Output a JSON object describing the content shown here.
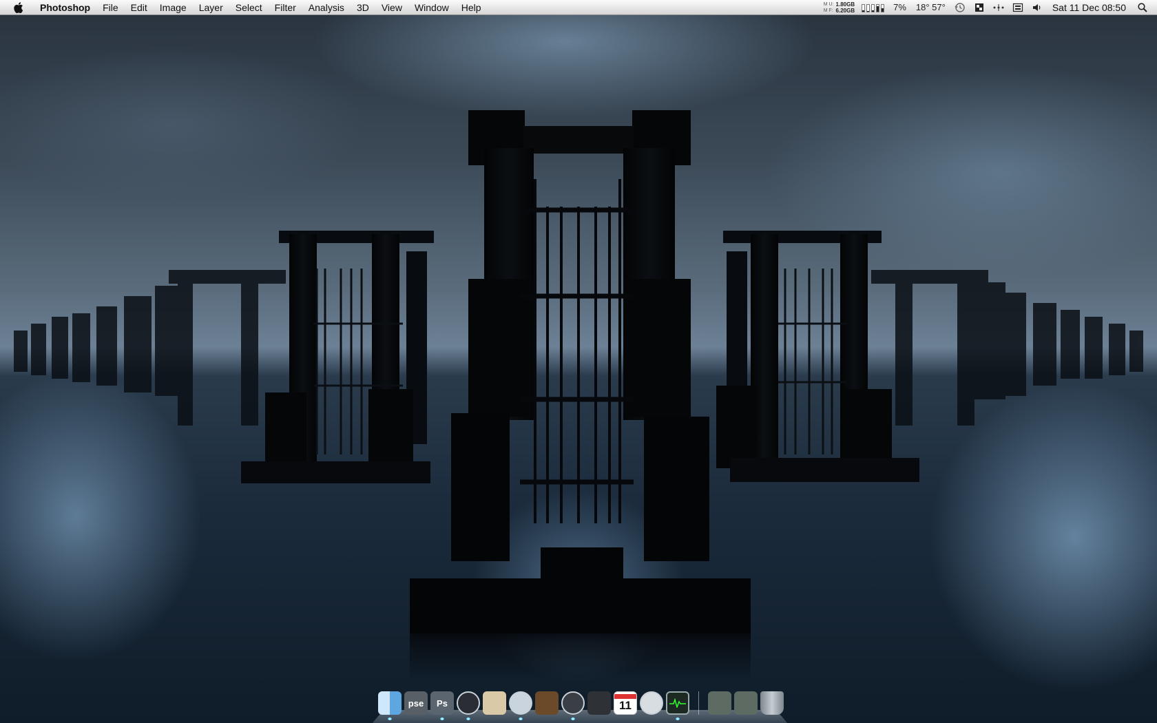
{
  "menubar": {
    "apple_icon": "apple-logo-icon",
    "app_name": "Photoshop",
    "menus": [
      "File",
      "Edit",
      "Image",
      "Layer",
      "Select",
      "Filter",
      "Analysis",
      "3D",
      "View",
      "Window",
      "Help"
    ],
    "memory": {
      "label_top": "M U:",
      "label_bottom": "M F:",
      "used": "1.80GB",
      "free": "6.20GB"
    },
    "cpu_percent": "7%",
    "temperatures": "18° 57°",
    "status_icons": [
      "time-machine-icon",
      "unknown-menu-extra-icon",
      "bluetooth-dots-icon",
      "keyboard-input-icon",
      "volume-icon"
    ],
    "clock": "Sat 11 Dec  08:50",
    "spotlight_icon": "spotlight-search-icon"
  },
  "dock": {
    "items": [
      {
        "name": "Finder",
        "icon": "finder-icon",
        "color": "#7fb6e6",
        "label": "",
        "running": true
      },
      {
        "name": "Photoshop Elements",
        "icon": "pse-icon",
        "color": "#585f66",
        "label": "pse",
        "running": false
      },
      {
        "name": "Photoshop",
        "icon": "ps-icon",
        "color": "#5b6570",
        "label": "Ps",
        "running": true
      },
      {
        "name": "Aperture",
        "icon": "aperture-icon",
        "color": "#2a2d33",
        "label": "",
        "running": true
      },
      {
        "name": "Preview",
        "icon": "preview-icon",
        "color": "#d9c9a7",
        "label": "",
        "running": false
      },
      {
        "name": "Safari",
        "icon": "safari-compass-icon",
        "color": "#c9d4de",
        "label": "",
        "running": true
      },
      {
        "name": "Address Book",
        "icon": "address-book-icon",
        "color": "#6b4a2a",
        "label": "",
        "running": false
      },
      {
        "name": "iTunes",
        "icon": "itunes-icon",
        "color": "#3a3f45",
        "label": "",
        "running": true
      },
      {
        "name": "Logic",
        "icon": "music-notes-icon",
        "color": "#2e3136",
        "label": "",
        "running": false
      },
      {
        "name": "iCal",
        "icon": "calendar-icon",
        "color": "#ffffff",
        "label": "11",
        "running": false
      },
      {
        "name": "DVD Player",
        "icon": "disc-icon",
        "color": "#d8dde2",
        "label": "",
        "running": false
      },
      {
        "name": "Activity Monitor",
        "icon": "activity-monitor-icon",
        "color": "#1d2a23",
        "label": "",
        "running": true
      },
      {
        "name": "Downloads",
        "icon": "downloads-folder-icon",
        "color": "#5e6b63",
        "label": "",
        "running": false
      },
      {
        "name": "Documents",
        "icon": "documents-folder-icon",
        "color": "#5e6b63",
        "label": "",
        "running": false
      },
      {
        "name": "Trash",
        "icon": "trash-icon",
        "color": "#9aa3aa",
        "label": "",
        "running": false
      }
    ]
  },
  "colors": {
    "menubar_top": "#fbfbfb",
    "menubar_bottom": "#d6d6d6",
    "sky": "#5a6c7c",
    "water": "#1b2b3c",
    "structure": "#050607"
  }
}
